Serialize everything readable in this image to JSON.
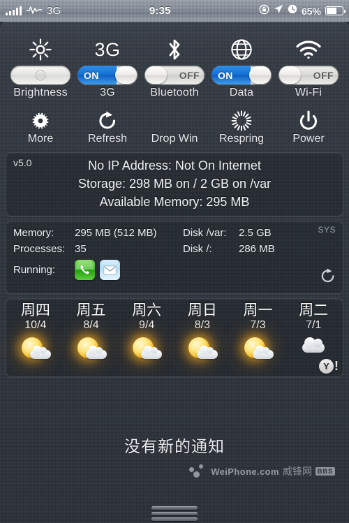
{
  "statusbar": {
    "signal_icon": "signal-bars-icon",
    "activity_icon": "activity-waveform-icon",
    "carrier": "3G",
    "time": "9:35",
    "rotation_lock_icon": "rotation-lock-icon",
    "location_icon": "location-arrow-icon",
    "alarm_icon": "alarm-clock-icon",
    "battery_percent": "65%",
    "battery_icon": "battery-icon"
  },
  "toggles": [
    {
      "label": "Brightness",
      "icon": "brightness-sun-icon",
      "type": "slider",
      "state": "",
      "value": 50
    },
    {
      "label": "3G",
      "icon": "3g-text-icon",
      "type": "switch",
      "state": "ON"
    },
    {
      "label": "Bluetooth",
      "icon": "bluetooth-icon",
      "type": "switch",
      "state": "OFF"
    },
    {
      "label": "Data",
      "icon": "globe-icon",
      "type": "switch",
      "state": "ON"
    },
    {
      "label": "Wi-Fi",
      "icon": "wifi-icon",
      "type": "switch",
      "state": "OFF"
    }
  ],
  "actions": [
    {
      "label": "More",
      "icon": "gear-icon"
    },
    {
      "label": "Refresh",
      "icon": "refresh-arrow-icon"
    },
    {
      "label": "Drop Win",
      "icon": "none"
    },
    {
      "label": "Respring",
      "icon": "spinner-icon"
    },
    {
      "label": "Power",
      "icon": "power-icon"
    }
  ],
  "info": {
    "version": "v5.0",
    "lines": [
      "No IP Address: Not On Internet",
      "Storage: 298 MB on / 2 GB on /var",
      "Available Memory: 295 MB"
    ]
  },
  "sys": {
    "tag": "SYS",
    "refresh_icon": "refresh-arrow-icon",
    "rows": [
      {
        "key": "Memory:",
        "value": "295 MB (512 MB)",
        "key2": "Disk /var:",
        "value2": "2.5 GB"
      },
      {
        "key": "Processes:",
        "value": "35",
        "key2": "Disk /:",
        "value2": "286 MB"
      }
    ],
    "running_label": "Running:",
    "running_apps": [
      {
        "name": "Phone",
        "icon": "phone-app-icon"
      },
      {
        "name": "Mail",
        "icon": "mail-app-icon"
      }
    ]
  },
  "weather": {
    "provider_badge": "Y!",
    "days": [
      {
        "day": "周四",
        "temps": "10/4",
        "icon": "sun-cloud-icon"
      },
      {
        "day": "周五",
        "temps": "8/4",
        "icon": "sun-cloud-icon"
      },
      {
        "day": "周六",
        "temps": "9/4",
        "icon": "sun-cloud-icon"
      },
      {
        "day": "周日",
        "temps": "8/3",
        "icon": "sun-cloud-icon"
      },
      {
        "day": "周一",
        "temps": "7/3",
        "icon": "sun-cloud-icon"
      },
      {
        "day": "周二",
        "temps": "7/1",
        "icon": "cloud-icon"
      }
    ]
  },
  "notifications": {
    "empty_text": "没有新的通知"
  },
  "watermark": {
    "site": "WeiPhone.com",
    "cn": "威锋网",
    "bbs": "BBS"
  },
  "colors": {
    "accent_blue": "#1570d4",
    "panel_bg": "#2f353d",
    "text_primary": "#f1f3f5",
    "phone_green": "#39b520",
    "mail_blue": "#9cd3f6"
  }
}
